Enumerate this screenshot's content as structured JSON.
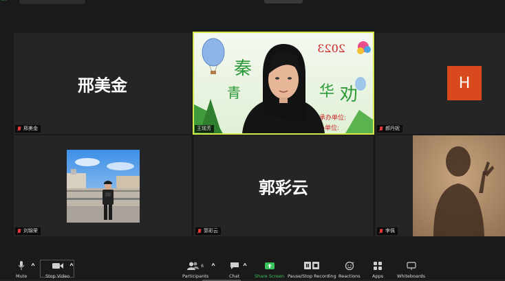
{
  "meeting": {
    "tiles": [
      {
        "big_name": "邢美金",
        "tag": "邢美金"
      },
      {
        "big_name": "",
        "tag": "王瑶芳"
      },
      {
        "avatar_letter": "H",
        "tag": "郝丹妮"
      },
      {
        "big_name": "",
        "tag": "刘锦荣"
      },
      {
        "big_name": "郭彩云",
        "tag": "郭彩云"
      },
      {
        "big_name": "",
        "tag": "李佩"
      }
    ]
  },
  "toolbar": {
    "mute": "Mute",
    "stop_video": "Stop Video",
    "participants": "Participants",
    "participants_count": "6",
    "chat": "Chat",
    "share_screen": "Share Screen",
    "record": "Pause/Stop Recording",
    "reactions": "Reactions",
    "apps": "Apps",
    "whiteboards": "Whiteboards"
  },
  "colors": {
    "background": "#1a1a1a",
    "tile": "#252525",
    "active_border": "#d6e84a",
    "share_green": "#3ac45c",
    "avatar_orange": "#d84a1e",
    "muted_red": "#e23a3a"
  }
}
